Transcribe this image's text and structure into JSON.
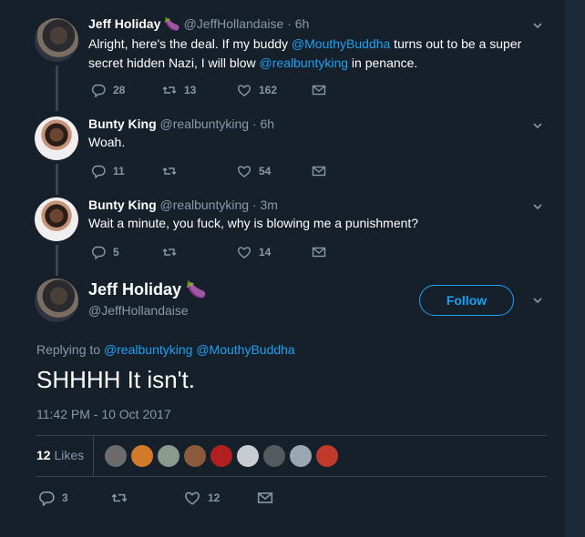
{
  "thread": [
    {
      "name": "Jeff Holiday",
      "emoji": "🍆",
      "handle": "@JeffHollandaise",
      "time": "· 6h",
      "text_parts": [
        "Alright, here's the deal. If my buddy ",
        "@MouthyBuddha",
        " turns out to be a super secret hidden Nazi, I will blow ",
        "@realbuntyking",
        " in penance."
      ],
      "replies": "28",
      "retweets": "13",
      "likes": "162"
    },
    {
      "name": "Bunty King",
      "handle": "@realbuntyking",
      "time": "· 6h",
      "text": "Woah.",
      "replies": "11",
      "retweets": "",
      "likes": "54"
    },
    {
      "name": "Bunty King",
      "handle": "@realbuntyking",
      "time": "· 3m",
      "text": "Wait a minute, you fuck, why is blowing me a punishment?",
      "replies": "5",
      "retweets": "",
      "likes": "14"
    }
  ],
  "main_tweet": {
    "name": "Jeff Holiday",
    "emoji": "🍆",
    "handle": "@JeffHollandaise",
    "follow_label": "Follow",
    "replying_prefix": "Replying to",
    "replying_to": [
      "@realbuntyking",
      "@MouthyBuddha"
    ],
    "text": "SHHHH It isn't.",
    "timestamp": "11:42 PM - 10 Oct 2017",
    "likes_count": "12",
    "likes_label": "Likes",
    "replies": "3",
    "retweets": "",
    "likes": "12"
  },
  "colors": {
    "background": "#15202b",
    "text": "#ffffff",
    "muted": "#8899a6",
    "accent": "#1da1f2",
    "divider": "#38444d"
  },
  "icons": [
    "reply-icon",
    "retweet-icon",
    "like-icon",
    "message-icon",
    "chevron-down-icon"
  ]
}
